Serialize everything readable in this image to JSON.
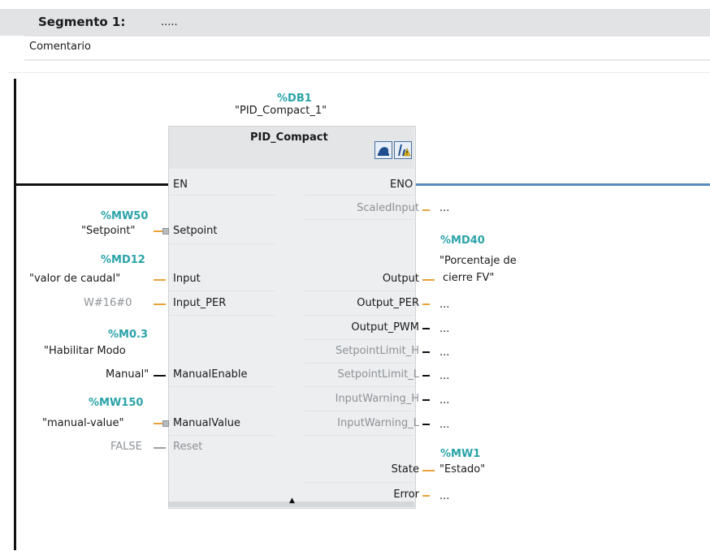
{
  "segment": {
    "title": "Segmento 1:",
    "dots": ".....",
    "comment": "Comentario"
  },
  "block": {
    "instance_db": "%DB1",
    "instance_name": "\"PID_Compact_1\"",
    "type_name": "PID_Compact",
    "en": "EN",
    "eno": "ENO",
    "inputs": [
      {
        "pin": "Setpoint",
        "tag": "%MW50",
        "symbol": "\"Setpoint\""
      },
      {
        "pin": "Input",
        "tag": "%MD12",
        "symbol": "\"valor de caudal\""
      },
      {
        "pin": "Input_PER",
        "value": "W#16#0"
      },
      {
        "pin": "ManualEnable",
        "tag": "%M0.3",
        "symbol_line1": "\"Habilitar Modo",
        "symbol_line2": "Manual\""
      },
      {
        "pin": "ManualValue",
        "tag": "%MW150",
        "symbol": "\"manual-value\""
      },
      {
        "pin": "Reset",
        "value": "FALSE"
      }
    ],
    "outputs": [
      {
        "pin": "ScaledInput",
        "value": "..."
      },
      {
        "pin": "Output",
        "tag": "%MD40",
        "symbol_line1": "\"Porcentaje de",
        "symbol_line2": "cierre FV\""
      },
      {
        "pin": "Output_PER",
        "value": "..."
      },
      {
        "pin": "Output_PWM",
        "value": "..."
      },
      {
        "pin": "SetpointLimit_H",
        "value": "..."
      },
      {
        "pin": "SetpointLimit_L",
        "value": "..."
      },
      {
        "pin": "InputWarning_H",
        "value": "..."
      },
      {
        "pin": "InputWarning_L",
        "value": "..."
      },
      {
        "pin": "State",
        "tag": "%MW1",
        "symbol": "\"Estado\""
      },
      {
        "pin": "Error",
        "value": "..."
      }
    ]
  },
  "icons": [
    "commissioning-icon",
    "configuration-icon"
  ],
  "colors": {
    "tag": "#2aa3a8",
    "connector": "#e8a23a",
    "eno_line": "#5a8cbf",
    "disabled_text": "#8e9297"
  }
}
